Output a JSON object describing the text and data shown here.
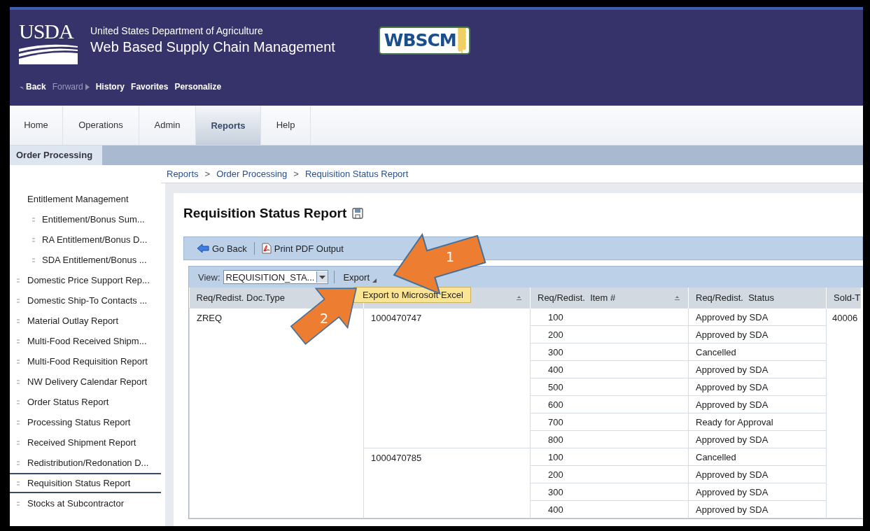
{
  "header": {
    "usda_logo": "USDA",
    "department": "United States Department of Agriculture",
    "app_title": "Web Based Supply Chain Management",
    "product_logo": "WBSCM"
  },
  "nav_links": [
    {
      "label": "Back",
      "kind": "back",
      "disabled": false
    },
    {
      "label": "Forward",
      "kind": "forward",
      "disabled": true
    },
    {
      "label": "History",
      "kind": "plain",
      "disabled": false
    },
    {
      "label": "Favorites",
      "kind": "plain",
      "disabled": false
    },
    {
      "label": "Personalize",
      "kind": "plain",
      "disabled": false
    }
  ],
  "tabs": [
    {
      "label": "Home",
      "selected": false
    },
    {
      "label": "Operations",
      "selected": false
    },
    {
      "label": "Admin",
      "selected": false
    },
    {
      "label": "Reports",
      "selected": true
    },
    {
      "label": "Help",
      "selected": false
    }
  ],
  "subtabs": [
    {
      "label": "Order Processing",
      "selected": true
    }
  ],
  "sidebar": {
    "items": [
      {
        "label": "Entitlement Management",
        "selected": false,
        "children": [
          {
            "label": "Entitlement/Bonus Sum...",
            "selected": false
          },
          {
            "label": "RA Entitlement/Bonus D...",
            "selected": false
          },
          {
            "label": "SDA Entitlement/Bonus ...",
            "selected": false
          }
        ]
      },
      {
        "label": "Domestic Price Support Rep...",
        "selected": false
      },
      {
        "label": "Domestic Ship-To Contacts ...",
        "selected": false
      },
      {
        "label": "Material Outlay Report",
        "selected": false
      },
      {
        "label": "Multi-Food Received Shipm...",
        "selected": false
      },
      {
        "label": "Multi-Food Requisition Report",
        "selected": false
      },
      {
        "label": "NW Delivery Calendar Report",
        "selected": false
      },
      {
        "label": "Order Status Report",
        "selected": false
      },
      {
        "label": "Processing Status Report",
        "selected": false
      },
      {
        "label": "Received Shipment Report",
        "selected": false
      },
      {
        "label": "Redistribution/Redonation D...",
        "selected": false
      },
      {
        "label": "Requisition Status Report",
        "selected": true
      },
      {
        "label": "Stocks at Subcontractor",
        "selected": false
      }
    ]
  },
  "breadcrumb": {
    "separator": ">",
    "items": [
      "Reports",
      "Order Processing",
      "Requisition Status Report"
    ]
  },
  "page_title": "Requisition Status Report",
  "toolbar": [
    {
      "label": "Go Back",
      "kind": "back"
    },
    {
      "label": "Print PDF Output",
      "kind": "pdf"
    }
  ],
  "view": {
    "label": "View:",
    "value": "REQUISITION_STA..."
  },
  "export": {
    "label": "Export",
    "menu": [
      "Export to Microsoft Excel"
    ]
  },
  "table": {
    "columns": [
      {
        "label": "Req/Redist. Doc.Type"
      },
      {
        "sortable": true
      },
      {
        "label": "Req/Redist.  Item #",
        "sortable": true
      },
      {
        "label": "Req/Redist.  Status",
        "sortable": false
      },
      {
        "label": "Sold-T"
      }
    ],
    "groups": [
      {
        "doc_type": "ZREQ",
        "sold_to": "40006",
        "documents": [
          {
            "number": "1000470747",
            "items": [
              {
                "item": "100",
                "status": "Approved by SDA"
              },
              {
                "item": "200",
                "status": "Approved by SDA"
              },
              {
                "item": "300",
                "status": "Cancelled"
              },
              {
                "item": "400",
                "status": "Approved by SDA"
              },
              {
                "item": "500",
                "status": "Approved by SDA"
              },
              {
                "item": "600",
                "status": "Approved by SDA"
              },
              {
                "item": "700",
                "status": "Ready for Approval"
              },
              {
                "item": "800",
                "status": "Approved by SDA"
              }
            ]
          },
          {
            "number": "1000470785",
            "items": [
              {
                "item": "100",
                "status": "Cancelled"
              },
              {
                "item": "200",
                "status": "Approved by SDA"
              },
              {
                "item": "300",
                "status": "Approved by SDA"
              },
              {
                "item": "400",
                "status": "Approved by SDA"
              }
            ]
          }
        ]
      }
    ]
  },
  "callouts": [
    {
      "number": "1"
    },
    {
      "number": "2"
    }
  ]
}
